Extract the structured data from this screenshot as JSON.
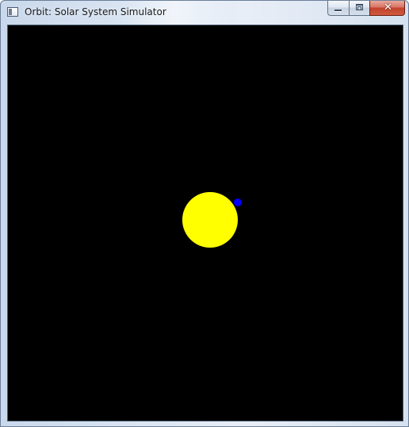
{
  "window": {
    "title": "Orbit: Solar System Simulator"
  },
  "titlebar": {
    "icon": "app-window-icon",
    "buttons": {
      "minimize_icon": "minimize-icon",
      "maximize_icon": "maximize-icon",
      "close_icon": "close-icon",
      "close_glyph": "✕"
    }
  },
  "simulation": {
    "background_color": "#000000",
    "sun": {
      "color": "#ffff00"
    },
    "planet": {
      "color": "#0000ff"
    }
  }
}
